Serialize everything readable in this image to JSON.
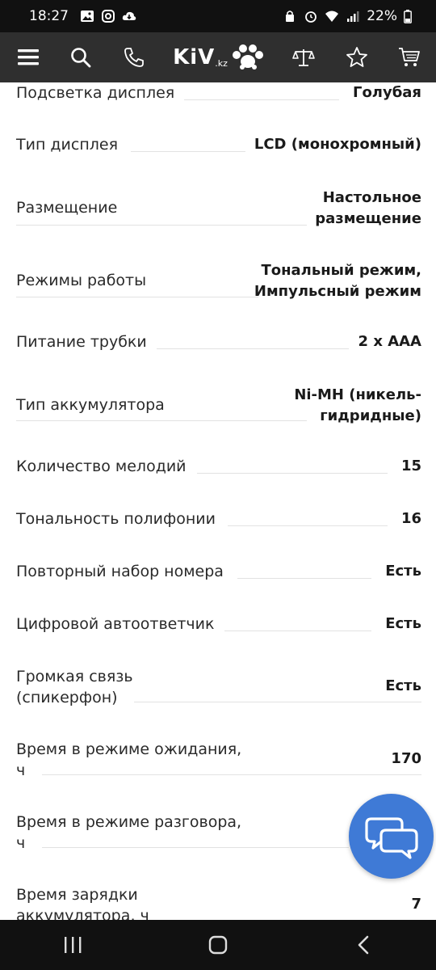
{
  "status_bar": {
    "time": "18:27",
    "battery_percent": "22%",
    "left_icons": [
      "gallery-icon",
      "instagram-icon",
      "cloud-download-icon"
    ],
    "right_icons": [
      "lock-icon",
      "alarm-icon",
      "wifi-icon",
      "signal-icon",
      "battery-icon"
    ]
  },
  "nav": {
    "logo_text": "KiV",
    "logo_suffix": ".kz",
    "icons": [
      "menu-icon",
      "search-icon",
      "phone-icon",
      "compare-scales-icon",
      "favorites-star-icon",
      "cart-icon"
    ]
  },
  "specs": [
    {
      "label": "Подсветка дисплея",
      "value": "Голубая"
    },
    {
      "label": "Тип дисплея",
      "value": "LCD (монохромный)"
    },
    {
      "label": "Размещение",
      "value": "Настольное\nразмещение"
    },
    {
      "label": "Режимы работы",
      "value": "Тональный режим,\nИмпульсный режим"
    },
    {
      "label": "Питание трубки",
      "value": "2 x AAA"
    },
    {
      "label": "Тип аккумулятора",
      "value": "Ni-MH (никель-\nгидридные)"
    },
    {
      "label": "Количество мелодий",
      "value": "15"
    },
    {
      "label": "Тональность полифонии",
      "value": "16"
    },
    {
      "label": "Повторный набор номера",
      "value": "Есть"
    },
    {
      "label": "Цифровой автоответчик",
      "value": "Есть"
    },
    {
      "label": "Громкая связь\n(спикерфон)",
      "value": "Есть"
    },
    {
      "label": "Время в режиме ожидания,\nч",
      "value": "170"
    },
    {
      "label": "Время в режиме разговора,\nч",
      "value": ""
    },
    {
      "label": "Время зарядки\nаккумулятора, ч",
      "value": "7"
    }
  ],
  "colors": {
    "nav_bg": "#2f2f2f",
    "status_bg": "#111111",
    "fab_bg": "#3f7ad6"
  }
}
